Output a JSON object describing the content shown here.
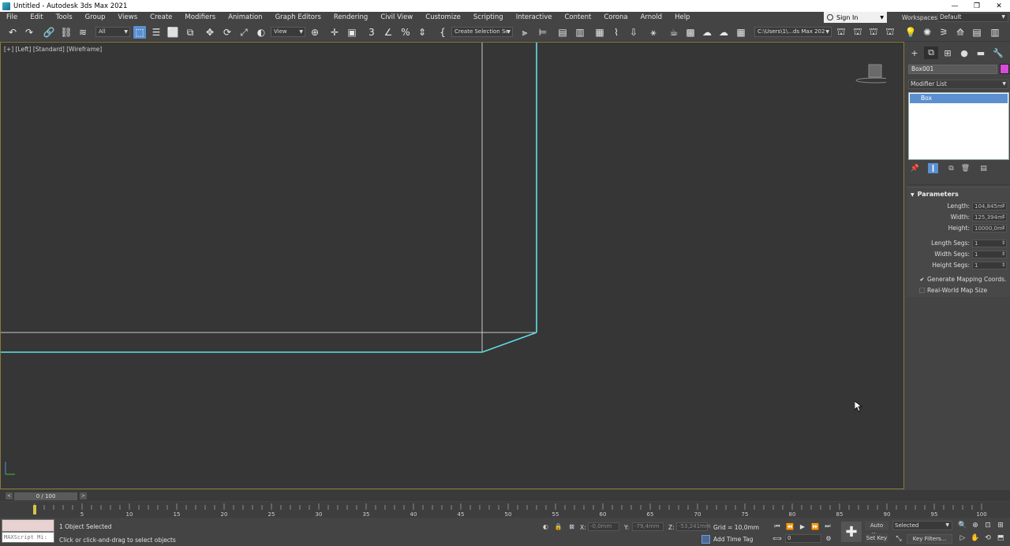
{
  "window": {
    "title": "Untitled - Autodesk 3ds Max 2021",
    "minimize": "—",
    "restore": "❐",
    "close": "✕"
  },
  "menu": {
    "items": [
      "File",
      "Edit",
      "Tools",
      "Group",
      "Views",
      "Create",
      "Modifiers",
      "Animation",
      "Graph Editors",
      "Rendering",
      "Civil View",
      "Customize",
      "Scripting",
      "Interactive",
      "Content",
      "Corona",
      "Arnold",
      "Help"
    ],
    "sign_in": "Sign In",
    "workspaces_label": "Workspaces:",
    "workspace_value": "Default"
  },
  "toolbar": {
    "filter_value": "All",
    "refcoord_value": "View",
    "named_selection": "Create Selection Se",
    "project_path": "C:\\Users\\1\\...ds Max 202"
  },
  "viewport": {
    "label": "[+] [Left] [Standard] [Wireframe]",
    "accent_color": "#5fe0e6",
    "edge_color": "#c8c8c8"
  },
  "command_panel": {
    "object_name": "Box001",
    "object_color": "#d74cd7",
    "modifier_list": "Modifier List",
    "stack_items": [
      "Box"
    ],
    "rollout_title": "Parameters",
    "params": [
      {
        "label": "Length:",
        "value": "104,845m"
      },
      {
        "label": "Width:",
        "value": "125,394m"
      },
      {
        "label": "Height:",
        "value": "10000,0m"
      },
      {
        "label": "Length Segs:",
        "value": "1"
      },
      {
        "label": "Width Segs:",
        "value": "1"
      },
      {
        "label": "Height Segs:",
        "value": "1"
      }
    ],
    "checkboxes": [
      {
        "label": "Generate Mapping Coords.",
        "checked": true
      },
      {
        "label": "Real-World Map Size",
        "checked": false
      }
    ]
  },
  "timeline": {
    "slider_text": "0 / 100",
    "prev": "<",
    "next": ">",
    "ticks": [
      5,
      10,
      15,
      20,
      25,
      30,
      35,
      40,
      45,
      50,
      55,
      60,
      65,
      70,
      75,
      80,
      85,
      90,
      95,
      100
    ],
    "current_frame": 0,
    "total_frames": 100
  },
  "status": {
    "maxscript_placeholder": "MAXScript Mi:",
    "selection_text": "1 Object Selected",
    "prompt_text": "Click or click-and-drag to select objects",
    "x_label": "X:",
    "x_value": "-0,0mm",
    "y_label": "Y:",
    "y_value": "-79,4mm",
    "z_label": "Z:",
    "z_value": "-53,241mm",
    "grid": "Grid = 10,0mm",
    "add_time_tag": "Add Time Tag",
    "frame_value": "0",
    "auto_key": "Auto Key",
    "set_key": "Set Key",
    "selected_drop": "Selected",
    "key_filters": "Key Filters..."
  }
}
